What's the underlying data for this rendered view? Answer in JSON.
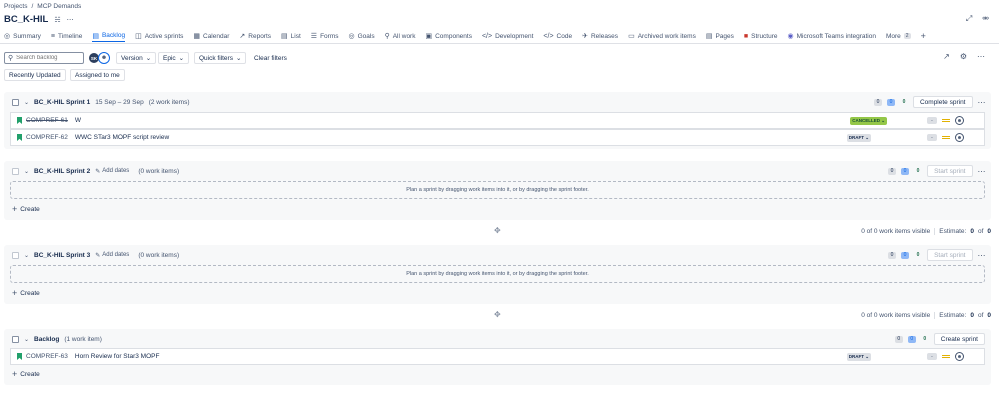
{
  "breadcrumb": {
    "root": "Projects",
    "sep": "/",
    "current": "MCP Demands"
  },
  "project": {
    "title": "BC_K-HIL"
  },
  "tabs": [
    {
      "label": "Summary",
      "icon": "globe-icon"
    },
    {
      "label": "Timeline",
      "icon": "timeline-icon"
    },
    {
      "label": "Backlog",
      "icon": "backlog-icon",
      "active": true
    },
    {
      "label": "Active sprints",
      "icon": "board-icon"
    },
    {
      "label": "Calendar",
      "icon": "calendar-icon"
    },
    {
      "label": "Reports",
      "icon": "chart-icon"
    },
    {
      "label": "List",
      "icon": "list-icon"
    },
    {
      "label": "Forms",
      "icon": "forms-icon"
    },
    {
      "label": "Goals",
      "icon": "goals-icon"
    },
    {
      "label": "All work",
      "icon": "all-work-icon"
    },
    {
      "label": "Components",
      "icon": "components-icon"
    },
    {
      "label": "Development",
      "icon": "development-icon"
    },
    {
      "label": "Code",
      "icon": "code-icon"
    },
    {
      "label": "Releases",
      "icon": "releases-icon"
    },
    {
      "label": "Archived work items",
      "icon": "archive-icon"
    },
    {
      "label": "Pages",
      "icon": "pages-icon"
    },
    {
      "label": "Structure",
      "icon": "structure-icon"
    },
    {
      "label": "Microsoft Teams integration",
      "icon": "teams-icon"
    }
  ],
  "tabs_more": {
    "label": "More",
    "count": "2"
  },
  "filters": {
    "search_placeholder": "Search backlog",
    "avatar_initials": "SK",
    "version": "Version",
    "epic": "Epic",
    "quick_filters": "Quick filters",
    "clear": "Clear filters",
    "recently_updated": "Recently Updated",
    "assigned_to_me": "Assigned to me"
  },
  "sprint1": {
    "name": "BC_K-HIL Sprint 1",
    "dates": "15 Sep – 29 Sep",
    "count": "(2 work items)",
    "todo": "0",
    "inprogress": "0",
    "done": "0",
    "button": "Complete sprint",
    "items": [
      {
        "key": "COMPREF-61",
        "summary": "W",
        "status": "CANCELLED",
        "estimate": "-",
        "strike": true
      },
      {
        "key": "COMPREF-62",
        "summary": "WWC STar3 MOPF script review",
        "status": "DRAFT",
        "estimate": "-",
        "strike": false
      }
    ]
  },
  "sprint2": {
    "name": "BC_K-HIL Sprint 2",
    "add_dates": "Add dates",
    "count": "(0 work items)",
    "todo": "0",
    "inprogress": "0",
    "done": "0",
    "button": "Start sprint",
    "drop_text": "Plan a sprint by dragging work items into it, or by dragging the sprint footer.",
    "create": "Create",
    "footer": {
      "visible": "0 of 0 work items visible",
      "estimate_label": "Estimate:",
      "estimate_a": "0",
      "of": "of",
      "estimate_b": "0"
    }
  },
  "sprint3": {
    "name": "BC_K-HIL Sprint 3",
    "add_dates": "Add dates",
    "count": "(0 work items)",
    "todo": "0",
    "inprogress": "0",
    "done": "0",
    "button": "Start sprint",
    "drop_text": "Plan a sprint by dragging work items into it, or by dragging the sprint footer.",
    "create": "Create",
    "footer": {
      "visible": "0 of 0 work items visible",
      "estimate_label": "Estimate:",
      "estimate_a": "0",
      "of": "of",
      "estimate_b": "0"
    }
  },
  "backlog": {
    "name": "Backlog",
    "count": "(1 work item)",
    "todo": "0",
    "inprogress": "0",
    "done": "0",
    "button": "Create sprint",
    "create": "Create",
    "items": [
      {
        "key": "COMPREF-63",
        "summary": "Horn Review for Star3 MOPF",
        "status": "DRAFT",
        "estimate": "-"
      }
    ]
  },
  "colors": {
    "accent": "#0c66e4",
    "story": "#22a06b",
    "cancelled": "#94c748",
    "priority": "#e2b203"
  }
}
